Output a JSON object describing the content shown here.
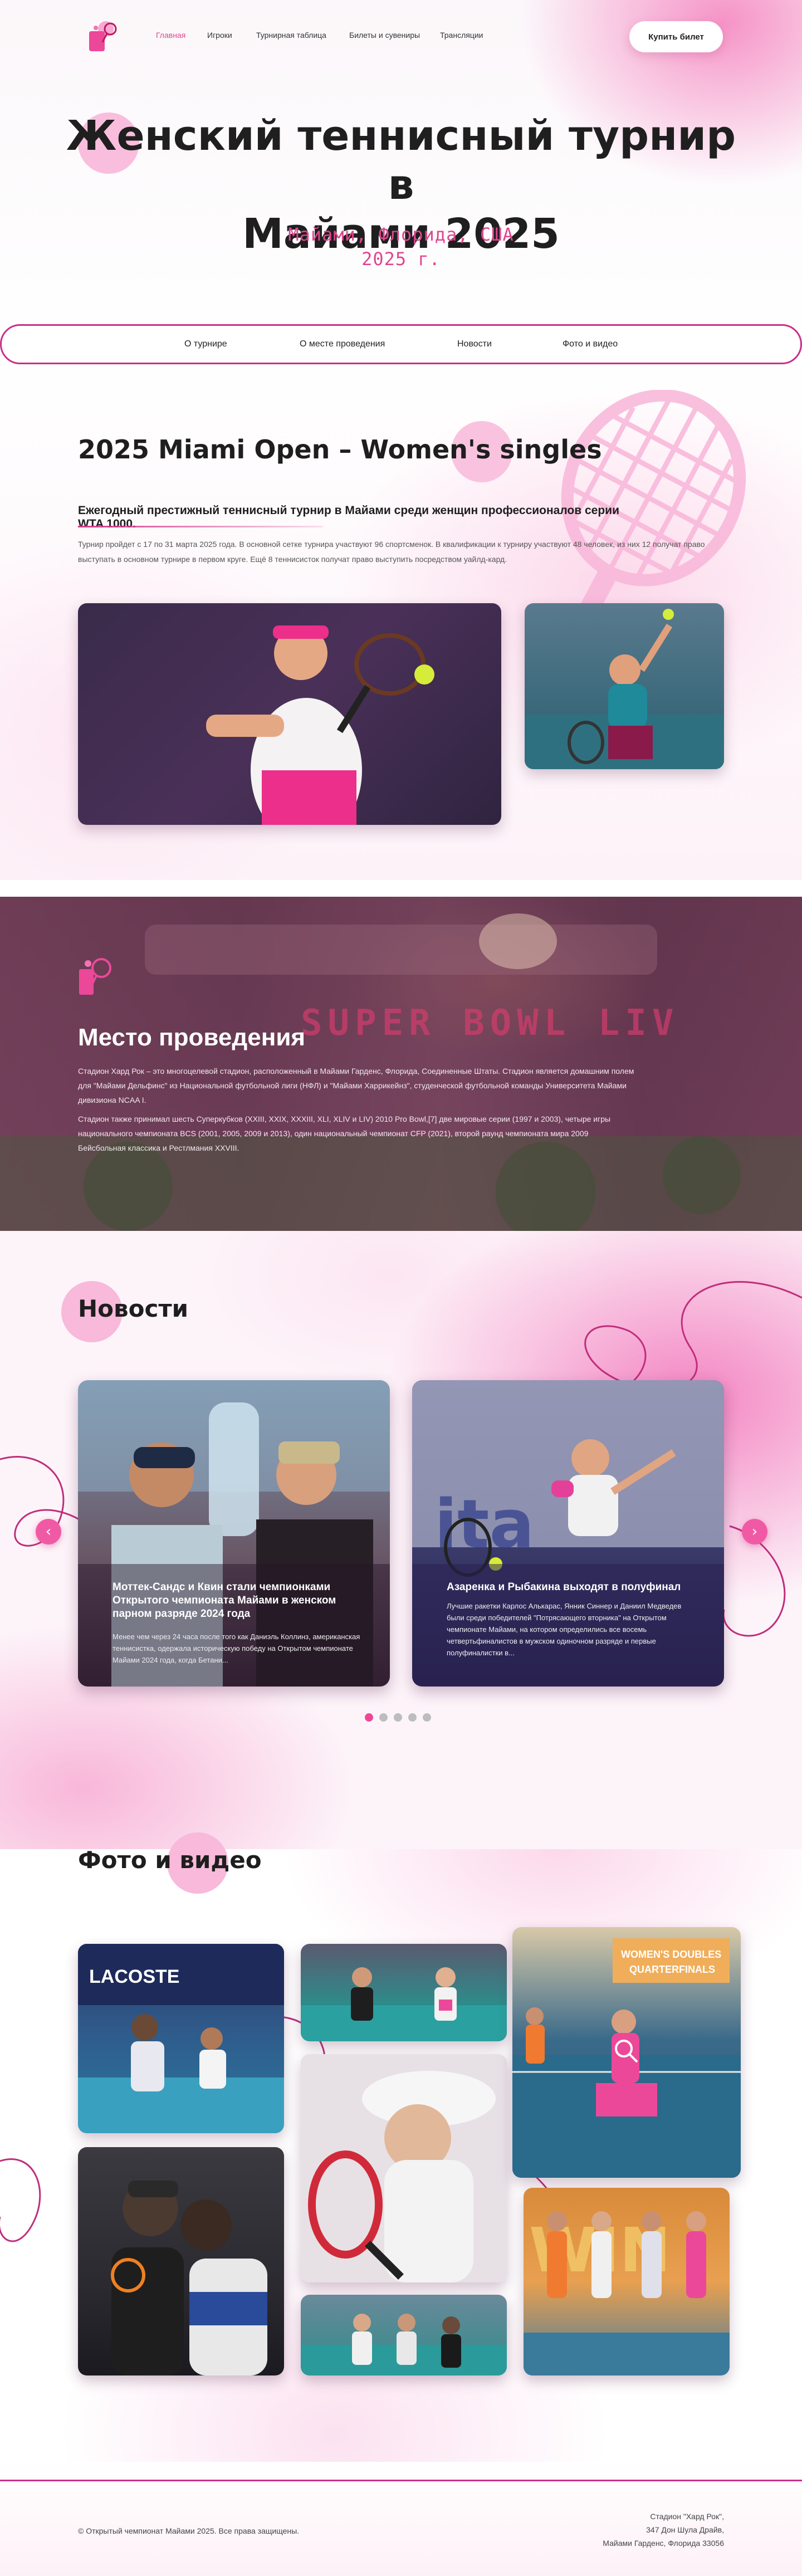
{
  "header": {
    "nav": [
      "Главная",
      "Игроки",
      "Турнирная таблица",
      "Билеты и сувениры",
      "Трансляции"
    ],
    "buy_button": "Купить билет"
  },
  "hero": {
    "title_line1": "Женский теннисный турнир в",
    "title_line2": "Майами 2025",
    "location": "Майами, Флорида, США",
    "year": "2025 г."
  },
  "section_tabs": [
    "О турнире",
    "О месте проведения",
    "Новости",
    "Фото и видео"
  ],
  "about": {
    "title": "2025 Miami Open – Women's singles",
    "lead": "Ежегодный престижный теннисный турнир в Майами среди женщин профессионалов серии WTA 1000.",
    "text": "Турнир пройдет с 17 по 31 марта 2025 года. В основной сетке турнира участвуют 96 спортсменок. В квалификации к турниру участвуют 48 человек, из них 12 получат право выступать в основном турнире в первом круге. Ещё 8 теннисисток получат право выступить посредством уайлд-кард."
  },
  "venue": {
    "title": "Место проведения",
    "p1": "Стадион Хард Рок – это многоцелевой стадион, расположенный в Майами Гарденс, Флорида, Соединенные Штаты. Стадион является домашним полем для \"Майами Дельфинс\" из Национальной футбольной лиги (НФЛ) и \"Майами Харрикейнз\", студенческой футбольной команды Университета Майами дивизиона NCAA I.",
    "p2": "Стадион также принимал шесть Суперкубков (XXIII, XXIX, XXXIII, XLI, XLIV и LIV) 2010 Pro Bowl,[7] две мировые серии (1997 и 2003), четыре игры национального чемпионата BCS (2001, 2005, 2009 и 2013), один национальный чемпионат CFP (2021), второй раунд чемпионата мира 2009 Бейсбольная классика и Рестлмания XXVIII.",
    "sign": "SUPER BOWL LIV"
  },
  "news": {
    "title": "Новости",
    "cards": [
      {
        "title": "Моттек-Сандс и Квин стали чемпионками Открытого чемпионата Майами в женском парном разряде 2024 года",
        "text": "Менее чем через 24 часа после того как Даниэль Коллинз, американская теннисистка, одержала историческую победу на Открытом чемпионате Майами 2024 года, когда Бетани..."
      },
      {
        "title": "Азаренка и Рыбакина выходят в полуфинал",
        "text": "Лучшие ракетки Карлос Алькарас, Янник Синнер и Даниил Медведев были среди победителей \"Потрясающего вторника\" на Открытом чемпионате Майами, на котором определились все восемь четвертьфиналистов в мужском одиночном разряде и первые полуфиналистки в..."
      }
    ],
    "prev": "‹",
    "next": "›",
    "pages": 5,
    "active_page": 1
  },
  "gallery": {
    "title": "Фото и видео"
  },
  "footer": {
    "copyright": "© Открытый чемпионат Майами 2025. Все права защищены.",
    "address_line1": "Стадион \"Хард Рок\",",
    "address_line2": "347 Дон Шула Драйв,",
    "address_line3": "Майами Гарденс, Флорида 33056"
  },
  "colors": {
    "accent": "#e0468f",
    "border": "#c9308a",
    "arrow": "#f05aa5"
  }
}
